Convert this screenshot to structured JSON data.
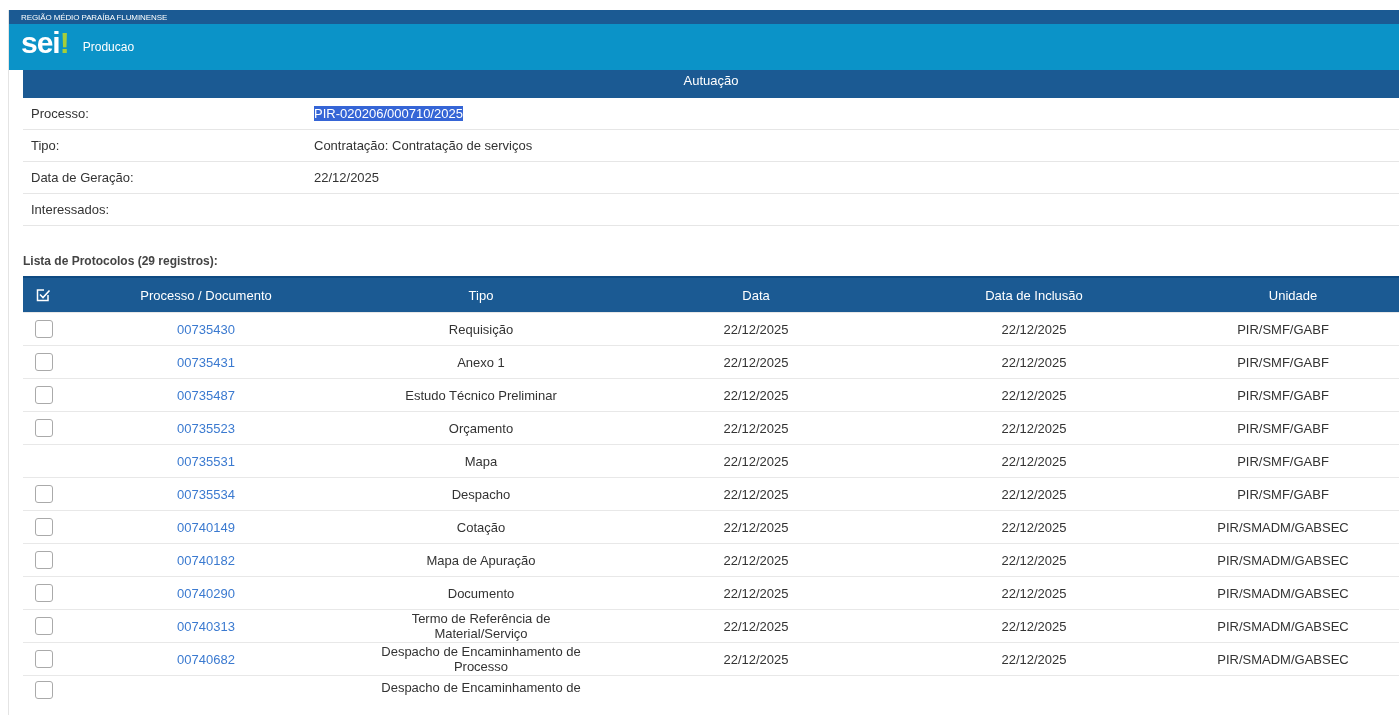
{
  "header": {
    "region": "REGIÃO MÉDIO PARAÍBA FLUMINENSE",
    "logo": {
      "text": "sei",
      "mark": "!"
    },
    "environment": "Producao"
  },
  "section_title": "Autuação",
  "process": {
    "label": "Processo:",
    "value": "PIR-020206/000710/2025",
    "text_selected": true
  },
  "details": [
    {
      "label": "Tipo:",
      "value": "Contratação: Contratação de serviços"
    },
    {
      "label": "Data de Geração:",
      "value": "22/12/2025"
    },
    {
      "label": "Interessados:"
    }
  ],
  "list_caption": "Lista de Protocolos (29 registros):",
  "table": {
    "columns": [
      "Processo / Documento",
      "Tipo",
      "Data",
      "Data de Inclusão",
      "Unidade"
    ],
    "rows": [
      {
        "kind": "checkbox",
        "checked": false,
        "document": "00735430",
        "tipo": "Requisição",
        "data": "22/12/2025",
        "inclusao": "22/12/2025",
        "unidade": "PIR/SMF/GABF"
      },
      {
        "kind": "checkbox",
        "checked": false,
        "document": "00735431",
        "tipo": "Anexo 1",
        "data": "22/12/2025",
        "inclusao": "22/12/2025",
        "unidade": "PIR/SMF/GABF"
      },
      {
        "kind": "checkbox",
        "checked": false,
        "document": "00735487",
        "tipo": "Estudo Técnico Preliminar",
        "data": "22/12/2025",
        "inclusao": "22/12/2025",
        "unidade": "PIR/SMF/GABF"
      },
      {
        "kind": "checkbox",
        "checked": false,
        "document": "00735523",
        "tipo": "Orçamento",
        "data": "22/12/2025",
        "inclusao": "22/12/2025",
        "unidade": "PIR/SMF/GABF"
      },
      {
        "kind": "plain",
        "document": "00735531",
        "tipo": "Mapa",
        "data": "22/12/2025",
        "inclusao": "22/12/2025",
        "unidade": "PIR/SMF/GABF"
      },
      {
        "kind": "checkbox",
        "checked": false,
        "document": "00735534",
        "tipo": "Despacho",
        "data": "22/12/2025",
        "inclusao": "22/12/2025",
        "unidade": "PIR/SMF/GABF"
      },
      {
        "kind": "checkbox",
        "checked": false,
        "document": "00740149",
        "tipo": "Cotação",
        "data": "22/12/2025",
        "inclusao": "22/12/2025",
        "unidade": "PIR/SMADM/GABSEC"
      },
      {
        "kind": "checkbox",
        "checked": false,
        "document": "00740182",
        "tipo": "Mapa de Apuração",
        "data": "22/12/2025",
        "inclusao": "22/12/2025",
        "unidade": "PIR/SMADM/GABSEC"
      },
      {
        "kind": "checkbox",
        "checked": false,
        "document": "00740290",
        "tipo": "Documento",
        "data": "22/12/2025",
        "inclusao": "22/12/2025",
        "unidade": "PIR/SMADM/GABSEC"
      },
      {
        "kind": "checkbox",
        "checked": false,
        "document": "00740313",
        "tipo": "Termo de Referência de Material/Serviço",
        "data": "22/12/2025",
        "inclusao": "22/12/2025",
        "unidade": "PIR/SMADM/GABSEC"
      },
      {
        "kind": "checkbox",
        "checked": false,
        "document": "00740682",
        "tipo": "Despacho de Encaminhamento de Processo",
        "data": "22/12/2025",
        "inclusao": "22/12/2025",
        "unidade": "PIR/SMADM/GABSEC"
      },
      {
        "kind": "checkbox",
        "checked": false,
        "tipo": "Despacho de Encaminhamento de"
      }
    ]
  }
}
